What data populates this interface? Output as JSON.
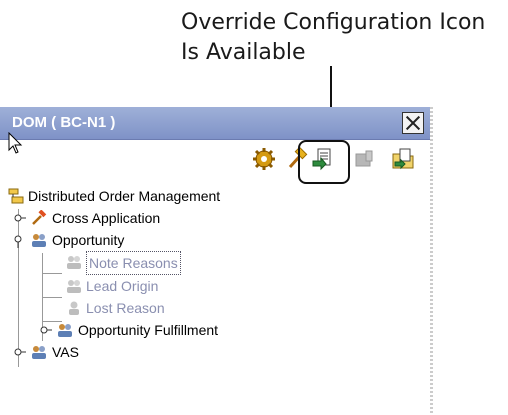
{
  "callout": {
    "line1": "Override Configuration Icon",
    "line2": "Is Available"
  },
  "window": {
    "title": "DOM ( BC-N1 )"
  },
  "toolbar": {
    "buttons": [
      {
        "icon": "gear-icon"
      },
      {
        "icon": "hammer-icon"
      },
      {
        "icon": "override-configuration-icon"
      },
      {
        "icon": "disabled-tool-icon"
      },
      {
        "icon": "folder-config-icon"
      }
    ]
  },
  "tree": {
    "root": "Distributed Order Management",
    "items": [
      {
        "label": "Cross Application"
      },
      {
        "label": "Opportunity"
      },
      {
        "label": "Note Reasons"
      },
      {
        "label": "Lead Origin"
      },
      {
        "label": "Lost Reason"
      },
      {
        "label": "Opportunity Fulfillment"
      },
      {
        "label": "VAS"
      }
    ]
  }
}
